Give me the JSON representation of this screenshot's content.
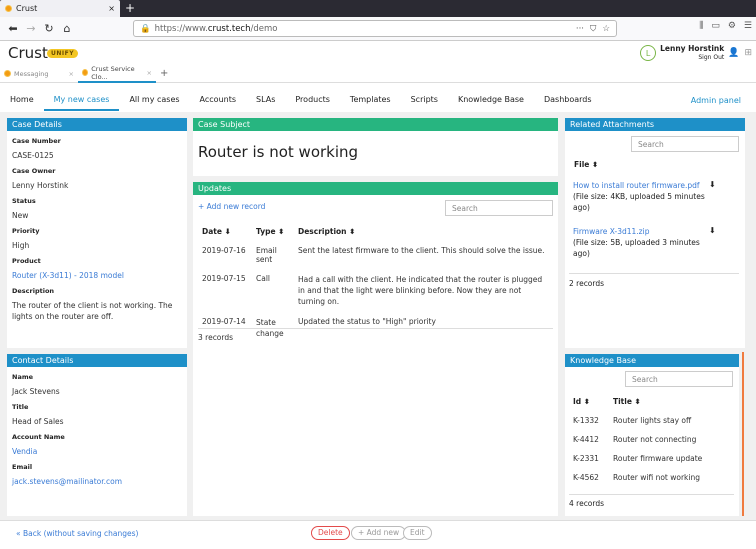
{
  "browser": {
    "tab_title": "Crust",
    "url_prefix": "https://www.",
    "url_domain": "crust.tech",
    "url_path": "/demo"
  },
  "app": {
    "name": "Crust",
    "badge": "UNIFY",
    "user_initial": "L",
    "user_name": "Lenny Horstink",
    "sign_out": "Sign Out"
  },
  "app_tabs": [
    {
      "label": "Messaging"
    },
    {
      "label": "Crust Service Clo..."
    }
  ],
  "nav": {
    "items": [
      "Home",
      "My new cases",
      "All my cases",
      "Accounts",
      "SLAs",
      "Products",
      "Templates",
      "Scripts",
      "Knowledge Base",
      "Dashboards"
    ],
    "admin": "Admin panel"
  },
  "case_details": {
    "title": "Case Details",
    "fields": [
      {
        "label": "Case Number",
        "value": "CASE-0125"
      },
      {
        "label": "Case Owner",
        "value": "Lenny Horstink"
      },
      {
        "label": "Status",
        "value": "New"
      },
      {
        "label": "Priority",
        "value": "High"
      },
      {
        "label": "Product",
        "value": "Router (X-3d11) - 2018 model"
      },
      {
        "label": "Description",
        "value": "The router of the client is not working. The lights on the router are off."
      }
    ]
  },
  "case_subject": {
    "title": "Case Subject",
    "value": "Router is not working"
  },
  "updates": {
    "title": "Updates",
    "add": "+ Add new record",
    "search_placeholder": "Search",
    "headers": [
      "Date ⬇",
      "Type ⬍",
      "Description ⬍"
    ],
    "rows": [
      {
        "date": "2019-07-16",
        "type": "Email sent",
        "desc": "Sent the latest firmware to the client. This should solve the issue."
      },
      {
        "date": "2019-07-15",
        "type": "Call",
        "desc": "Had a call with the client. He indicated that the router is plugged in and that the light were blinking before. Now they are not turning on."
      },
      {
        "date": "2019-07-14",
        "type": "State change",
        "desc": "Updated the status to \"High\" priority"
      }
    ],
    "count": "3 records"
  },
  "attachments": {
    "title": "Related Attachments",
    "search_placeholder": "Search",
    "header": "File ⬍",
    "files": [
      {
        "name": "How to install router firmware.pdf",
        "meta": "(File size: 4KB, uploaded 5 minutes ago)"
      },
      {
        "name": "Firmware X-3d11.zip",
        "meta": "(File size: 5B, uploaded 3 minutes ago)"
      }
    ],
    "count": "2 records"
  },
  "contact": {
    "title": "Contact Details",
    "fields": [
      {
        "label": "Name",
        "value": "Jack Stevens"
      },
      {
        "label": "Title",
        "value": "Head of Sales"
      },
      {
        "label": "Account Name",
        "value": "Vendia"
      },
      {
        "label": "Email",
        "value": "jack.stevens@mailinator.com"
      }
    ]
  },
  "kb": {
    "title": "Knowledge Base",
    "search_placeholder": "Search",
    "headers": [
      "Id ⬍",
      "Title ⬍"
    ],
    "rows": [
      {
        "id": "K-1332",
        "title": "Router lights stay off"
      },
      {
        "id": "K-4412",
        "title": "Router not connecting"
      },
      {
        "id": "K-2331",
        "title": "Router firmware update"
      },
      {
        "id": "K-4562",
        "title": "Router wifi not working"
      }
    ],
    "count": "4 records"
  },
  "footer": {
    "back": "« Back (without saving changes)",
    "delete": "Delete",
    "add": "+ Add new",
    "edit": "Edit"
  }
}
